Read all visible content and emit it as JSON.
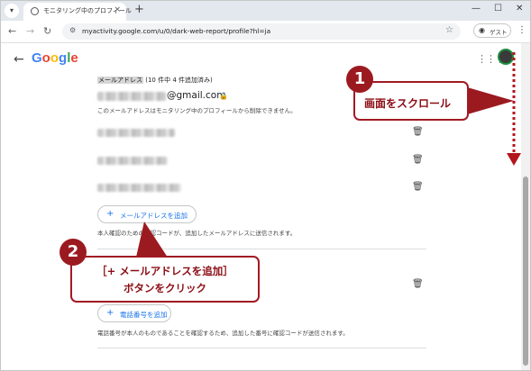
{
  "browser": {
    "tab_title": "モニタリング中のプロフィール",
    "tab_close": "×",
    "new_tab": "+",
    "url": "myactivity.google.com/u/0/dark-web-report/profile?hl=ja",
    "guest_label": "ゲスト",
    "icons": [
      "tab-list-icon",
      "globe-icon",
      "back-icon",
      "forward-icon",
      "reload-icon",
      "site-info-icon",
      "star-icon",
      "guest-icon",
      "menu-icon",
      "minimize-icon",
      "maximize-icon",
      "close-icon"
    ]
  },
  "page": {
    "logo": "Google",
    "section_label": "メールアドレス",
    "section_count": "(10 件中 4 件追加済み)",
    "email_suffix": "@gmail.com",
    "email_note": "このメールアドレスはモニタリング中のプロフィールから削除できません。",
    "add_email_label": "メールアドレスを追加",
    "add_email_note": "本人確認のための確認コードが、追加したメールアドレスに送信されます。",
    "add_phone_label": "電話番号を追加",
    "add_phone_note": "電話番号が本人のものであることを確認するため、追加した番号に確認コードが送信されます。"
  },
  "annotations": {
    "badge1": "1",
    "callout1": "画面をスクロール",
    "badge2": "2",
    "callout2_line1": "［+ メールアドレスを追加］",
    "callout2_line2": "ボタンをクリック",
    "color": "#9b1a20"
  },
  "colors": {
    "google_blue": "#4285F4",
    "google_red": "#EA4335",
    "google_yellow": "#FBBC05",
    "google_green": "#34A853",
    "link_blue": "#1a73e8"
  }
}
